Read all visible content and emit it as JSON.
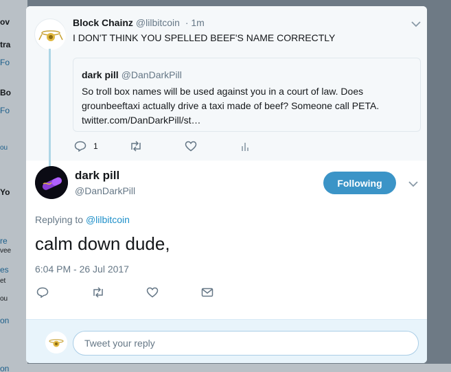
{
  "background": {
    "fragments": [
      "ov",
      "tra",
      "Fo",
      "Bo",
      "Fo",
      "ou",
      "Yo",
      "re",
      "vee",
      "es",
      "et",
      "ou",
      "on",
      "on"
    ]
  },
  "parent_tweet": {
    "name": "Block Chainz",
    "handle": "@lilbitcoin",
    "time": "· 1m",
    "text": "I DON'T THINK YOU SPELLED BEEF'S NAME CORRECTLY",
    "quoted": {
      "name": "dark pill",
      "handle": "@DanDarkPill",
      "lines": [
        "So troll box names will be used against you in a court of law. Does",
        "grounbeeftaxi actually drive a taxi made of beef? Someone call PETA.",
        "twitter.com/DanDarkPill/st…"
      ]
    },
    "reply_count": "1"
  },
  "main_tweet": {
    "name": "dark pill",
    "handle": "@DanDarkPill",
    "follow_label": "Following",
    "replying_prefix": "Replying to",
    "replying_to": "@lilbitcoin",
    "text": "calm down dude,",
    "timestamp": "6:04 PM - 26 Jul 2017"
  },
  "reply_bar": {
    "placeholder": "Tweet your reply"
  },
  "colors": {
    "accent": "#3b94c7",
    "link": "#1d8fc9",
    "thread_line": "#aed6e6",
    "muted": "#657786"
  }
}
